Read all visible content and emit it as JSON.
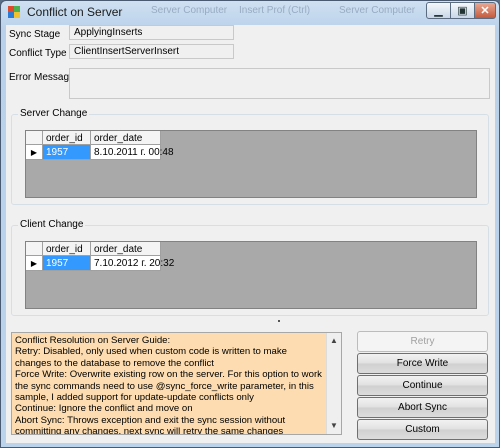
{
  "window": {
    "title": "Conflict on Server",
    "ghost_texts": [
      "Server Computer",
      "Insert Prof (Ctrl)",
      "Server Computer"
    ]
  },
  "form": {
    "sync_stage_label": "Sync Stage",
    "sync_stage_value": "ApplyingInserts",
    "conflict_type_label": "Conflict Type",
    "conflict_type_value": "ClientInsertServerInsert",
    "error_message_label": "Error Message",
    "error_message_value": ""
  },
  "server_change": {
    "legend": "Server Change",
    "columns": [
      "order_id",
      "order_date"
    ],
    "rows": [
      [
        "1957",
        "8.10.2011 г. 00:48"
      ]
    ]
  },
  "client_change": {
    "legend": "Client Change",
    "columns": [
      "order_id",
      "order_date"
    ],
    "rows": [
      [
        "1957",
        "7.10.2012 г. 20:32"
      ]
    ]
  },
  "guide": {
    "text": "Conflict Resolution on Server Guide:\nRetry: Disabled, only used when custom code is written to make changes to the database to remove the conflict\nForce Write: Overwrite existing row on the server. For this option to work the sync commands need to use @sync_force_write parameter, in this sample, I added support for update-update conflicts only\nContinue: Ignore the conflict and move on\nAbort Sync: Throws exception and exit the sync session without committing any changes, next sync will retry the same changes"
  },
  "buttons": {
    "retry": "Retry",
    "force_write": "Force Write",
    "continue": "Continue",
    "abort_sync": "Abort Sync",
    "custom": "Custom"
  }
}
